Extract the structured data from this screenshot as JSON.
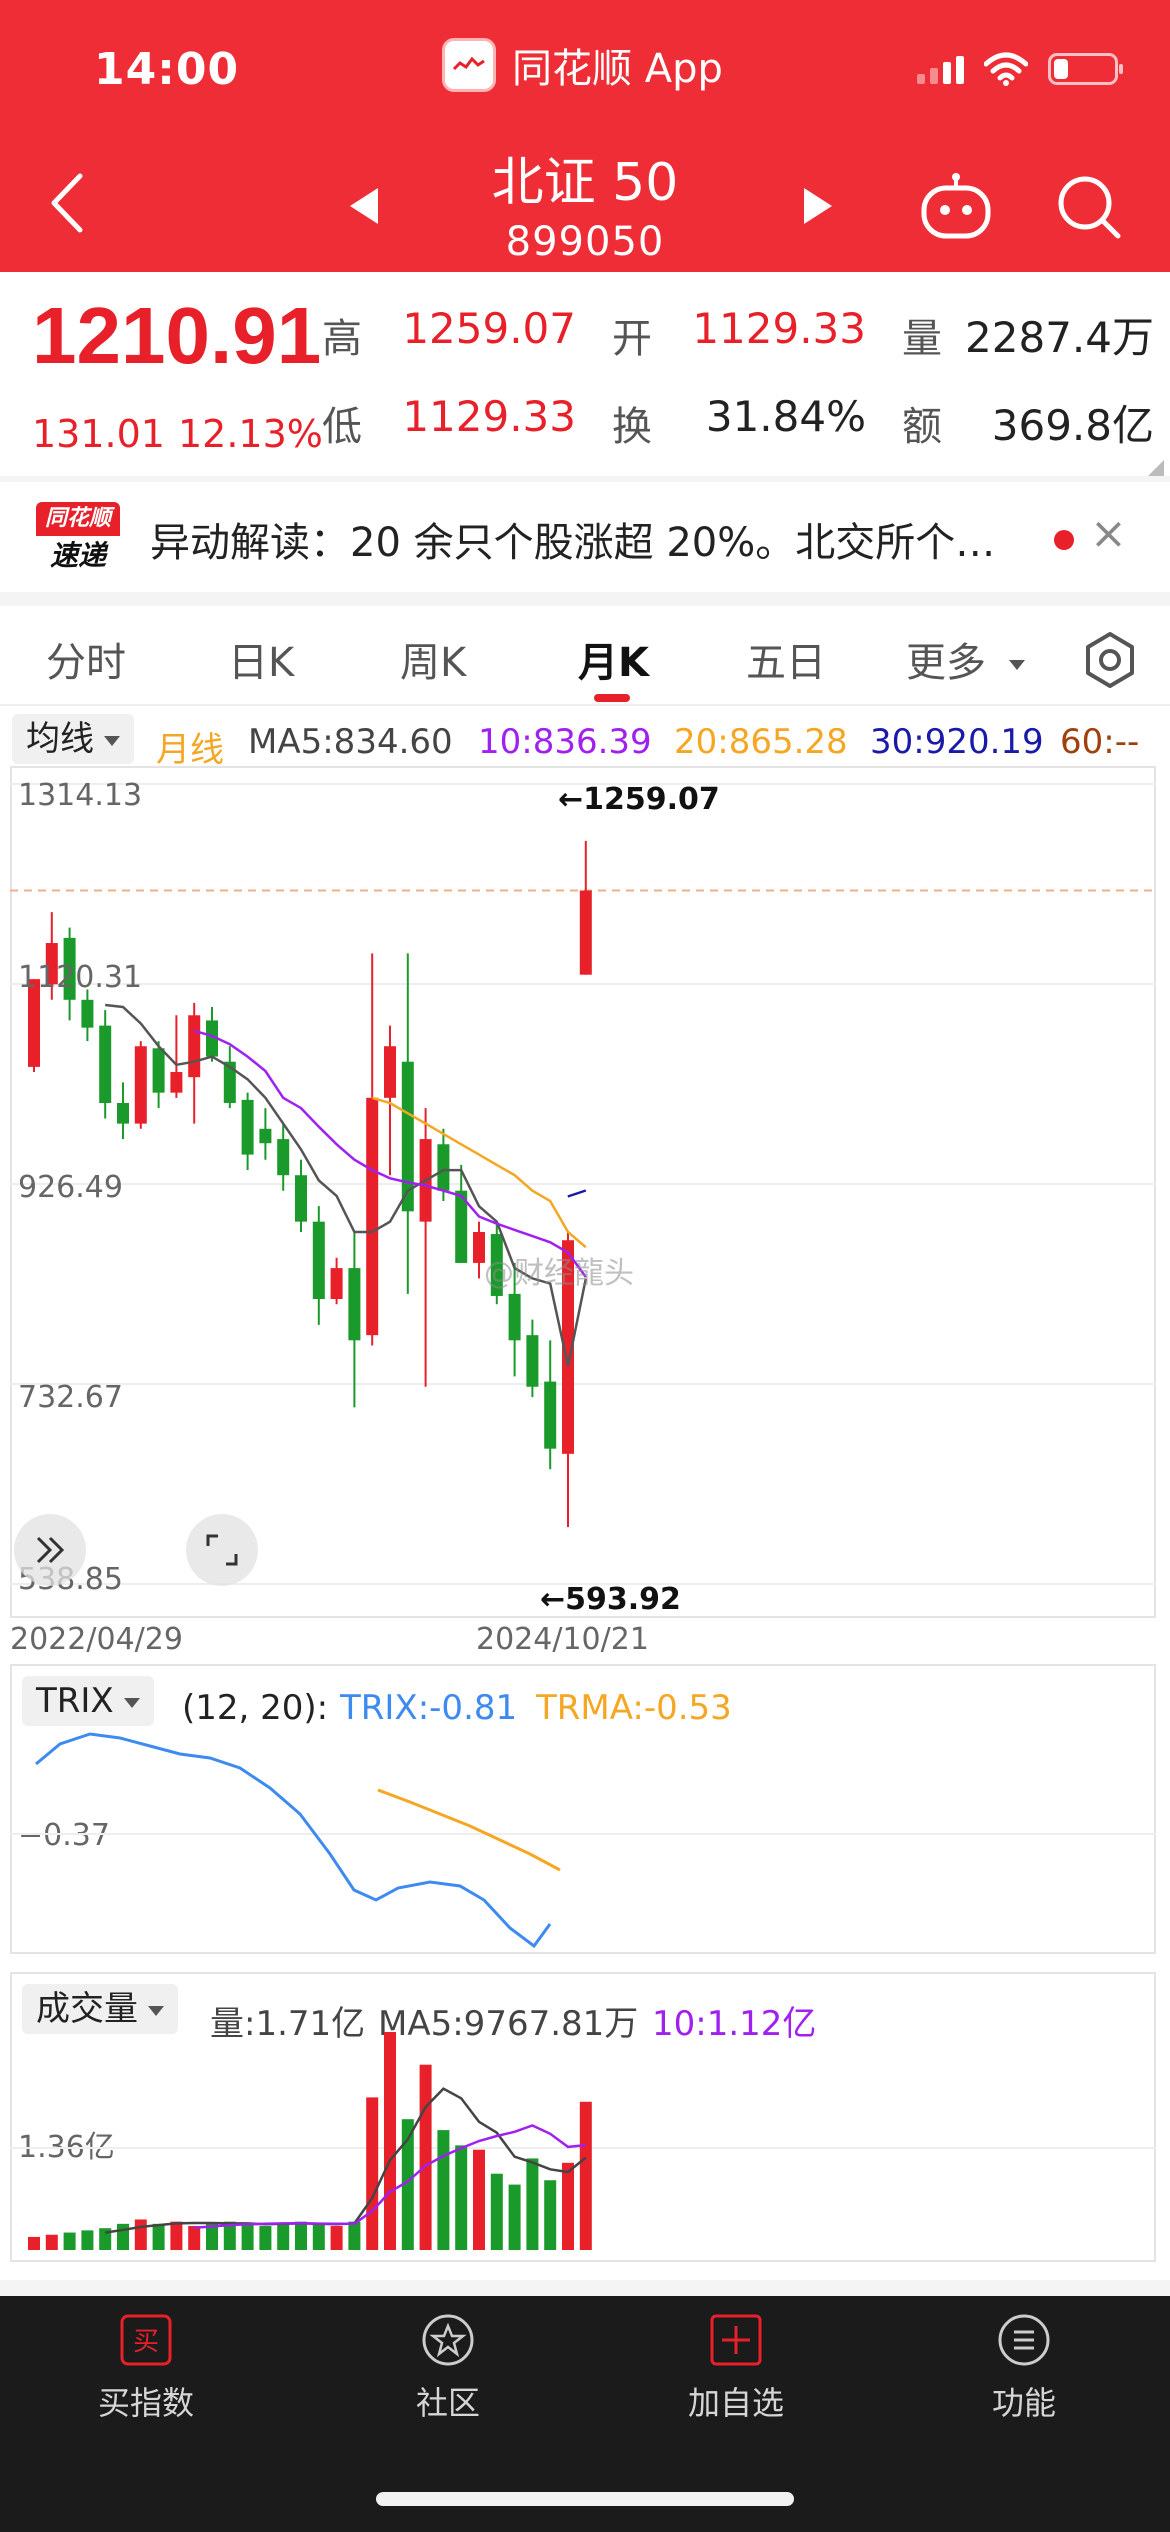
{
  "status": {
    "time": "14:00",
    "app_name": "同花顺 App"
  },
  "nav": {
    "title": "北证 50",
    "code": "899050"
  },
  "quote": {
    "price": "1210.91",
    "change": "131.01",
    "change_pct": "12.13%",
    "high_label": "高",
    "high": "1259.07",
    "low_label": "低",
    "low": "1129.33",
    "open_label": "开",
    "open": "1129.33",
    "turnover_label": "换",
    "turnover": "31.84%",
    "volume_label": "量",
    "volume": "2287.4万",
    "amount_label": "额",
    "amount": "369.8亿"
  },
  "news": {
    "logo_top": "同花顺",
    "logo_bottom": "速递",
    "text": "异动解读：20 余只个股涨超 20%。北交所个…",
    "close": "×"
  },
  "tabs": [
    "分时",
    "日K",
    "周K",
    "月K",
    "五日"
  ],
  "tab_more": "更多",
  "ma_row": {
    "chip": "均线",
    "period": "月线",
    "ma5": "MA5:834.60",
    "ma10": "10:836.39",
    "ma20": "20:865.28",
    "ma30": "30:920.19",
    "ma60": "60:--"
  },
  "colors": {
    "header": "#ee2d36",
    "up": "#e8202a",
    "down": "#1a9a2a",
    "ma5": "#555555",
    "ma10": "#a020f0",
    "ma20": "#f5a623",
    "ma30": "#1a1aa8",
    "trix": "#3d8af0",
    "trma": "#f5a623"
  },
  "chart_data": {
    "type": "candlestick",
    "y_axis_labels": [
      "1314.13",
      "1120.31",
      "926.49",
      "732.67",
      "538.85"
    ],
    "ylim": [
      538.85,
      1314.13
    ],
    "x_labels": [
      "2022/04/29",
      "2024/10/21"
    ],
    "max_annotation": "←1259.07",
    "min_annotation": "←593.92",
    "reference_line": 1210.91,
    "candles": [
      {
        "o": 1040,
        "h": 1125,
        "l": 1035,
        "c": 1125
      },
      {
        "o": 1120,
        "h": 1190,
        "l": 1105,
        "c": 1160
      },
      {
        "o": 1165,
        "h": 1175,
        "l": 1085,
        "c": 1105
      },
      {
        "o": 1105,
        "h": 1115,
        "l": 1065,
        "c": 1078
      },
      {
        "o": 1080,
        "h": 1095,
        "l": 990,
        "c": 1005
      },
      {
        "o": 1005,
        "h": 1025,
        "l": 970,
        "c": 985
      },
      {
        "o": 985,
        "h": 1065,
        "l": 980,
        "c": 1060
      },
      {
        "o": 1058,
        "h": 1065,
        "l": 1000,
        "c": 1015
      },
      {
        "o": 1015,
        "h": 1090,
        "l": 1010,
        "c": 1035
      },
      {
        "o": 1030,
        "h": 1102,
        "l": 985,
        "c": 1090
      },
      {
        "o": 1085,
        "h": 1098,
        "l": 1045,
        "c": 1050
      },
      {
        "o": 1045,
        "h": 1060,
        "l": 1000,
        "c": 1005
      },
      {
        "o": 1008,
        "h": 1015,
        "l": 940,
        "c": 955
      },
      {
        "o": 980,
        "h": 1000,
        "l": 950,
        "c": 966
      },
      {
        "o": 970,
        "h": 985,
        "l": 920,
        "c": 935
      },
      {
        "o": 935,
        "h": 950,
        "l": 880,
        "c": 890
      },
      {
        "o": 890,
        "h": 905,
        "l": 790,
        "c": 815
      },
      {
        "o": 815,
        "h": 855,
        "l": 810,
        "c": 845
      },
      {
        "o": 845,
        "h": 880,
        "l": 710,
        "c": 775
      },
      {
        "o": 780,
        "h": 1150,
        "l": 770,
        "c": 1010
      },
      {
        "o": 1010,
        "h": 1080,
        "l": 935,
        "c": 1060
      },
      {
        "o": 1045,
        "h": 1150,
        "l": 820,
        "c": 900
      },
      {
        "o": 890,
        "h": 1000,
        "l": 730,
        "c": 970
      },
      {
        "o": 965,
        "h": 980,
        "l": 910,
        "c": 920
      },
      {
        "o": 920,
        "h": 945,
        "l": 850,
        "c": 850
      },
      {
        "o": 850,
        "h": 890,
        "l": 835,
        "c": 880
      },
      {
        "o": 878,
        "h": 890,
        "l": 810,
        "c": 818
      },
      {
        "o": 820,
        "h": 850,
        "l": 740,
        "c": 775
      },
      {
        "o": 780,
        "h": 795,
        "l": 720,
        "c": 730
      },
      {
        "o": 735,
        "h": 775,
        "l": 650,
        "c": 670
      },
      {
        "o": 665,
        "h": 880,
        "l": 594,
        "c": 872
      },
      {
        "o": 1129.33,
        "h": 1259.07,
        "l": 1129.33,
        "c": 1210.91
      }
    ],
    "ma_series": [
      {
        "name": "MA5",
        "values": [
          null,
          null,
          null,
          null,
          1100,
          1098,
          1082,
          1060,
          1042,
          1045,
          1050,
          1040,
          1028,
          1010,
          985,
          960,
          930,
          915,
          880,
          880,
          890,
          920,
          930,
          940,
          940,
          905,
          890,
          845,
          835,
          830,
          750,
          834.6
        ]
      },
      {
        "name": "MA10",
        "values": [
          null,
          null,
          null,
          null,
          null,
          null,
          null,
          null,
          null,
          1075,
          1070,
          1062,
          1050,
          1036,
          1010,
          1000,
          982,
          965,
          950,
          940,
          932,
          928,
          925,
          920,
          915,
          895,
          888,
          882,
          876,
          870,
          860,
          836.39
        ]
      },
      {
        "name": "MA20",
        "values": [
          null,
          null,
          null,
          null,
          null,
          null,
          null,
          null,
          null,
          null,
          null,
          null,
          null,
          null,
          null,
          null,
          null,
          null,
          null,
          1010,
          1005,
          995,
          985,
          975,
          965,
          955,
          945,
          935,
          920,
          910,
          880,
          865.28
        ]
      }
    ],
    "trix": {
      "params": "(12, 20):",
      "trix_label": "TRIX:-0.81",
      "trma_label": "TRMA:-0.53",
      "axis_label": "−0.37",
      "chip": "TRIX"
    },
    "volume": {
      "chip": "成交量",
      "vol_label": "量:1.71亿",
      "ma5_label": "MA5:9767.81万",
      "ma10_label": "10:1.12亿",
      "axis_label": "1.36亿"
    }
  },
  "bottom_bar": [
    "买指数",
    "社区",
    "加自选",
    "功能"
  ],
  "watermark": "@财经龍头"
}
